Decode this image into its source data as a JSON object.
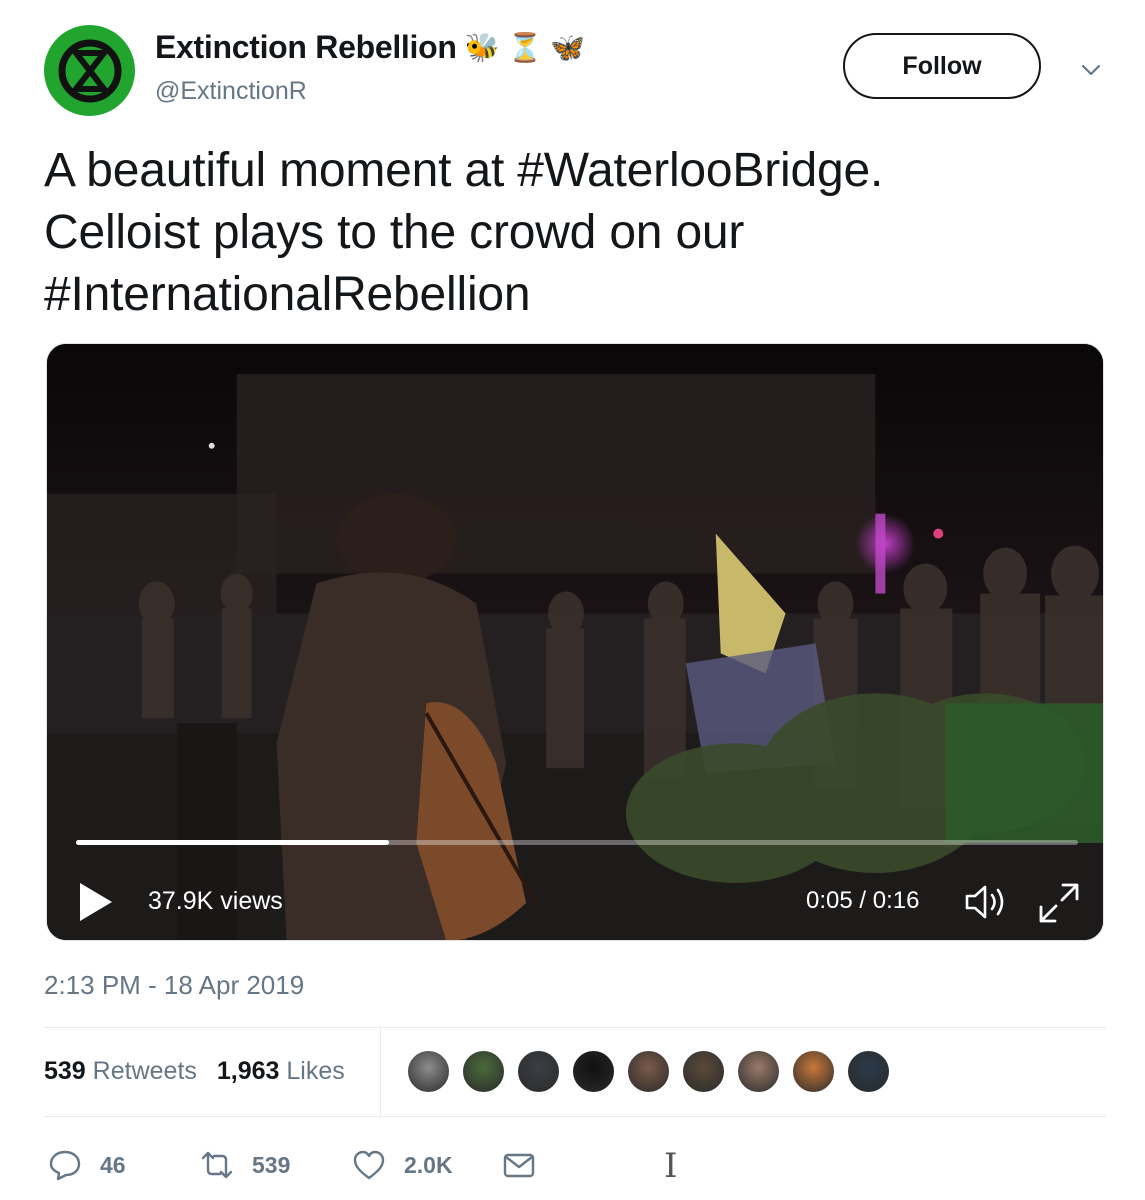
{
  "user": {
    "display_name": "Extinction Rebellion",
    "emoji": [
      "🐝",
      "⏳",
      "🦋"
    ],
    "handle": "@ExtinctionR",
    "avatar_color": "#21a52f"
  },
  "follow_label": "Follow",
  "tweet": {
    "lines": [
      "A beautiful moment at #WaterlooBridge.",
      "Celloist plays to the crowd on our",
      "#InternationalRebellion"
    ]
  },
  "video": {
    "views": "37.9K views",
    "time": "0:05 / 0:16",
    "progress": 0.3125
  },
  "timestamp": "2:13 PM - 18 Apr 2019",
  "stats": {
    "retweets_count": "539",
    "retweets_label": "Retweets",
    "likes_count": "1,963",
    "likes_label": "Likes"
  },
  "likers": [
    "#8c8c8c",
    "#4a6b3a",
    "#3a3f44",
    "#111111",
    "#7a5a4a",
    "#5a4a3a",
    "#9a7a6a",
    "#c9783a",
    "#2a3a4a"
  ],
  "actions": {
    "reply_count": "46",
    "retweet_count": "539",
    "like_count": "2.0K"
  },
  "colors": {
    "text_primary": "#14171a",
    "text_secondary": "#657786",
    "divider": "#e6ecf0"
  }
}
